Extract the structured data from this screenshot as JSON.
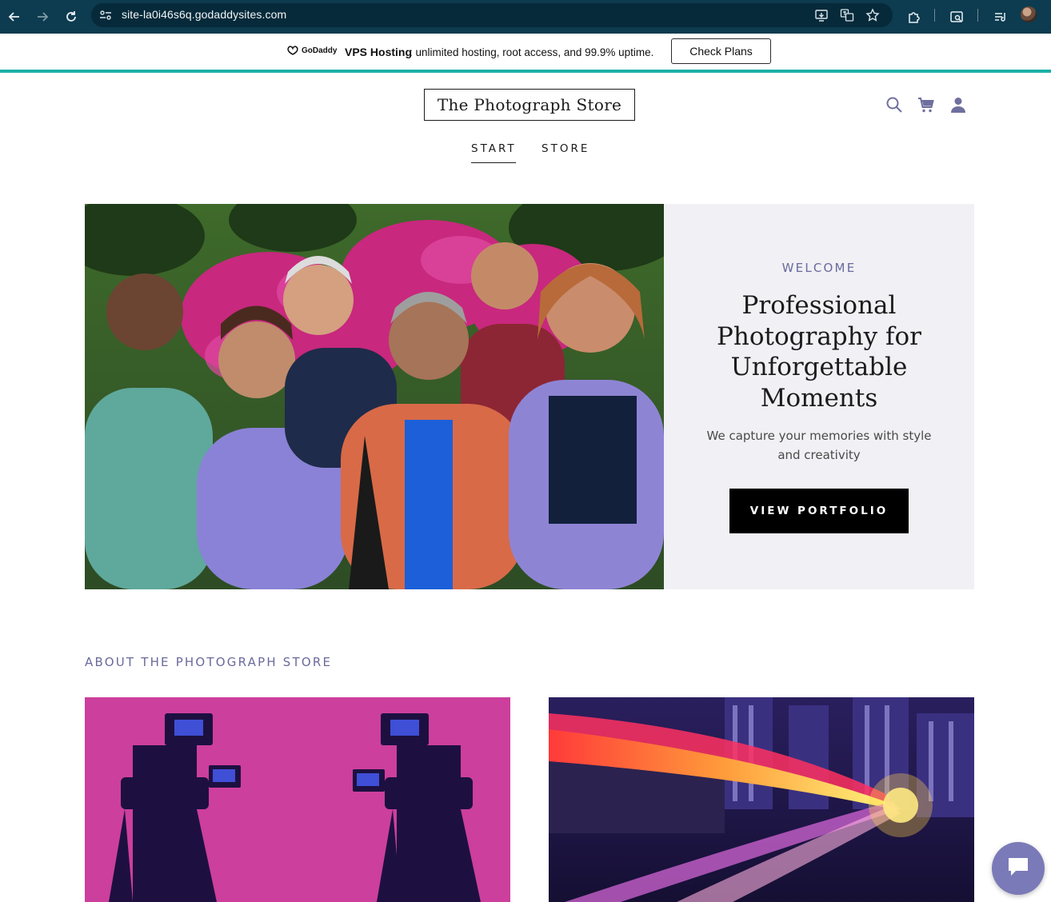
{
  "browser": {
    "url": "site-la0i46s6q.godaddysites.com"
  },
  "promo": {
    "logo_text": "GoDaddy",
    "strong": "VPS Hosting",
    "text": ": unlimited hosting, root access, and 99.9% uptime.",
    "button": "Check Plans"
  },
  "header": {
    "site_title": "The Photograph Store",
    "nav": [
      {
        "label": "START",
        "active": true
      },
      {
        "label": "STORE",
        "active": false
      }
    ],
    "icons": [
      "search-icon",
      "cart-icon",
      "account-icon"
    ]
  },
  "hero": {
    "eyebrow": "WELCOME",
    "title": "Professional Photography for Unforgettable Moments",
    "subtitle": "We capture your memories with style and creativity",
    "button": "VIEW PORTFOLIO"
  },
  "about": {
    "heading": "ABOUT THE PHOTOGRAPH STORE"
  },
  "colors": {
    "chrome_bg": "#0d3b4f",
    "promo_accent": "#1bb0a7",
    "brand_accent": "#6a6a9c",
    "hero_panel_bg": "#f0f0f5",
    "button_bg": "#000000",
    "chat_fab": "#7a7ab8"
  }
}
